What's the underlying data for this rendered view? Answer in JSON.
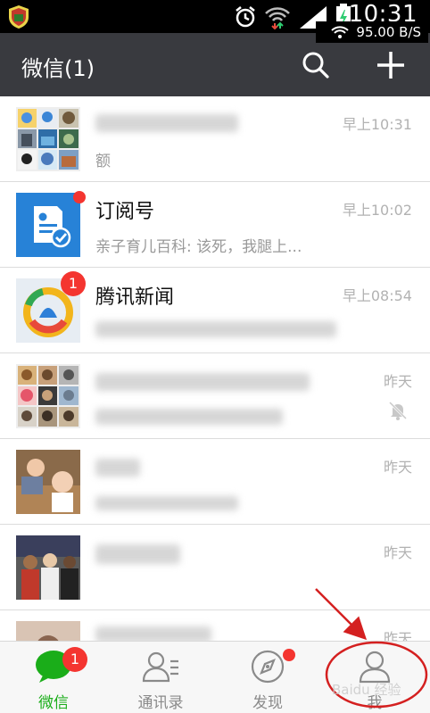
{
  "status_bar": {
    "time": "10:31",
    "net_speed": "95.00 B/S"
  },
  "header": {
    "title": "微信(1)",
    "search_icon": "search-icon",
    "add_icon": "plus-icon"
  },
  "chats": [
    {
      "name": "",
      "preview": "额",
      "time": "早上10:31"
    },
    {
      "name": "订阅号",
      "preview": "亲子育儿百科: 该死，我腿上...",
      "time": "早上10:02"
    },
    {
      "name": "腾讯新闻",
      "preview": "",
      "time": "早上08:54",
      "badge": "1"
    },
    {
      "name": "",
      "preview": "",
      "time": "昨天"
    },
    {
      "name": "",
      "preview": "",
      "time": "昨天"
    },
    {
      "name": "",
      "preview": "",
      "time": "昨天"
    },
    {
      "name": "",
      "preview": "",
      "time": "昨天"
    }
  ],
  "tabs": [
    {
      "label": "微信",
      "badge": "1",
      "icon": "chat-bubble-icon"
    },
    {
      "label": "通讯录",
      "icon": "contacts-icon"
    },
    {
      "label": "发现",
      "icon": "compass-icon"
    },
    {
      "label": "我",
      "icon": "person-icon"
    }
  ],
  "watermark": "Baidu 经验",
  "colors": {
    "header_bg": "#393a3f",
    "accent_green": "#1aad19",
    "badge_red": "#f43530",
    "annotation_red": "#d42020"
  }
}
